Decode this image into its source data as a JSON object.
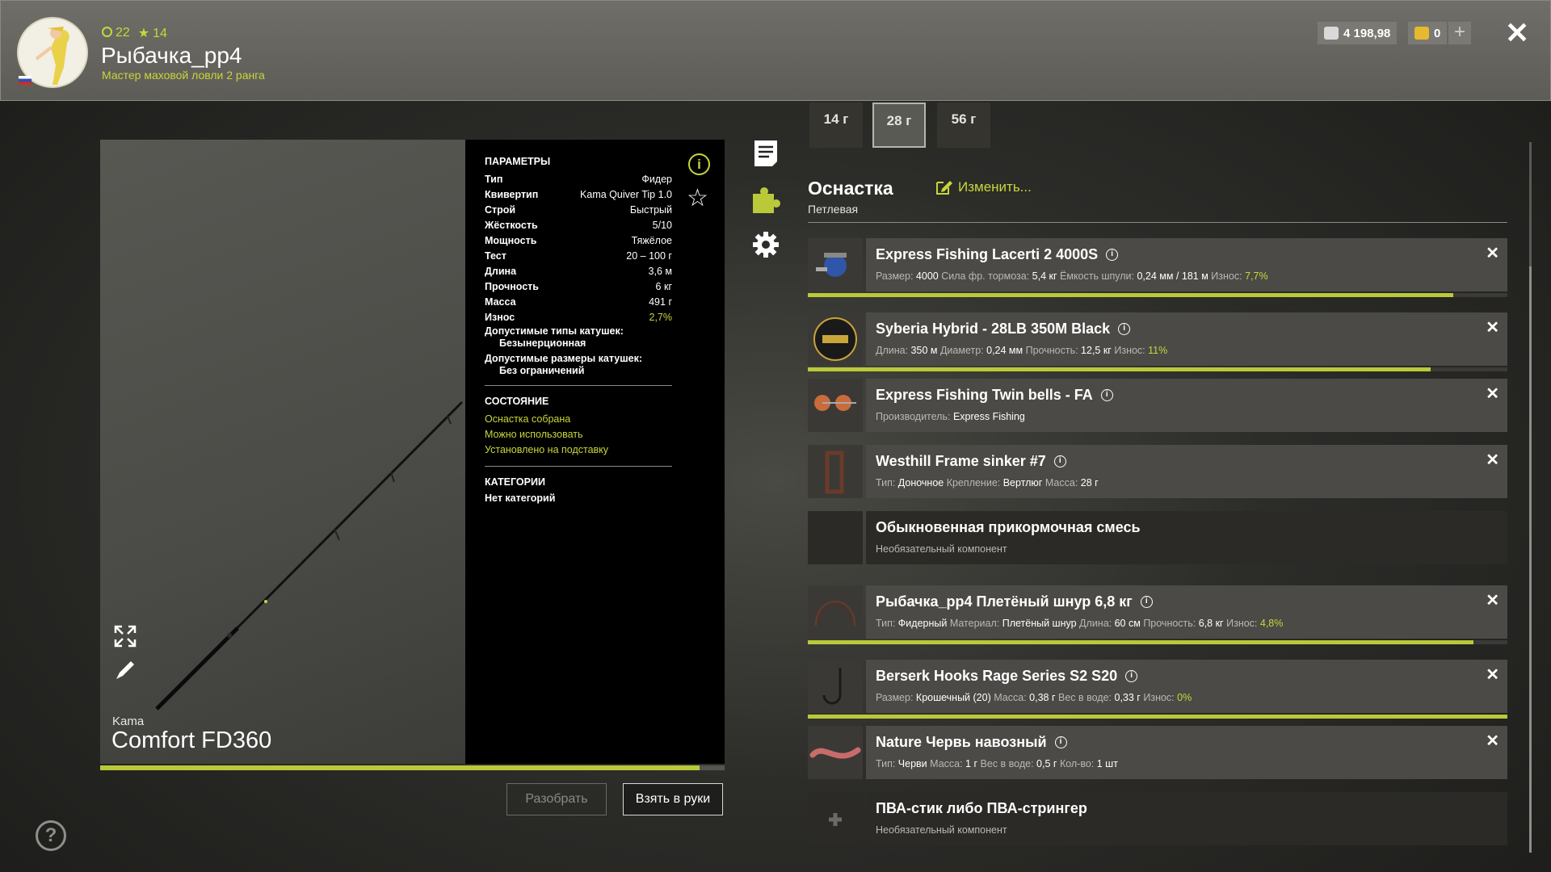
{
  "header": {
    "level": "22",
    "stars": "14",
    "player_name": "Рыбачка_pp4",
    "rank": "Мастер маховой ловли 2 ранга",
    "silver": "4 198,98",
    "gold": "0"
  },
  "rod": {
    "brand": "Kama",
    "name": "Comfort FD360",
    "wear_fraction": 0.96,
    "params_title": "ПАРАМЕТРЫ",
    "params": [
      {
        "k": "Тип",
        "v": "Фидер"
      },
      {
        "k": "Квивертип",
        "v": "Kama Quiver Tip 1.0"
      },
      {
        "k": "Строй",
        "v": "Быстрый"
      },
      {
        "k": "Жёсткость",
        "v": "5/10"
      },
      {
        "k": "Мощность",
        "v": "Тяжёлое"
      },
      {
        "k": "Тест",
        "v": "20 – 100 г"
      },
      {
        "k": "Длина",
        "v": "3,6 м"
      },
      {
        "k": "Прочность",
        "v": "6 кг"
      },
      {
        "k": "Масса",
        "v": "491 г"
      },
      {
        "k": "Износ",
        "v": "2,7%"
      }
    ],
    "reel_types_label": "Допустимые типы катушек:",
    "reel_types_value": "Безынерционная",
    "reel_sizes_label": "Допустимые размеры катушек:",
    "reel_sizes_value": "Без ограничений",
    "state_title": "СОСТОЯНИЕ",
    "states": [
      "Оснастка собрана",
      "Можно использовать",
      "Установлено на подставку"
    ],
    "categories_title": "КАТЕГОРИИ",
    "categories_value": "Нет категорий",
    "btn_disassemble": "Разобрать",
    "btn_take": "Взять в руки"
  },
  "weights": [
    "14 г",
    "28 г",
    "56 г"
  ],
  "tackle": {
    "title": "Оснастка",
    "subtitle": "Петлевая",
    "change": "Изменить..."
  },
  "items": [
    {
      "title": "Express Fishing Lacerti 2 4000S",
      "meta": [
        [
          "Размер:",
          "4000"
        ],
        [
          "Сила фр. тормоза:",
          "5,4 кг"
        ],
        [
          "Ёмкость шпули:",
          "0,24 мм / 181 м"
        ],
        [
          "Износ:",
          "7,7%"
        ]
      ],
      "bar": 0.923
    },
    {
      "title": "Syberia Hybrid - 28LB 350M Black",
      "meta": [
        [
          "Длина:",
          "350 м"
        ],
        [
          "Диаметр:",
          "0,24 мм"
        ],
        [
          "Прочность:",
          "12,5 кг"
        ],
        [
          "Износ:",
          "11%"
        ]
      ],
      "bar": 0.89
    },
    {
      "title": "Express Fishing Twin bells - FA",
      "meta": [
        [
          "Производитель:",
          "Express Fishing"
        ]
      ]
    },
    {
      "title": "Westhill Frame sinker #7",
      "meta": [
        [
          "Тип:",
          "Доночное"
        ],
        [
          "Крепление:",
          "Вертлюг"
        ],
        [
          "Масса:",
          "28 г"
        ]
      ]
    },
    {
      "title": "Обыкновенная прикормочная смесь",
      "meta": [
        [
          "Необязательный компонент",
          ""
        ]
      ]
    },
    {
      "title": "Рыбачка_pp4 Плетёный шнур 6,8 кг",
      "meta": [
        [
          "Тип:",
          "Фидерный"
        ],
        [
          "Материал:",
          "Плетёный шнур"
        ],
        [
          "Длина:",
          "60 см"
        ],
        [
          "Прочность:",
          "6,8 кг"
        ],
        [
          "Износ:",
          "4,8%"
        ]
      ],
      "bar": 0.952
    },
    {
      "title": "Berserk Hooks Rage Series S2 S20",
      "meta": [
        [
          "Размер:",
          "Крошечный (20)"
        ],
        [
          "Масса:",
          "0,38 г"
        ],
        [
          "Вес в воде:",
          "0,33 г"
        ],
        [
          "Износ:",
          "0%"
        ]
      ],
      "bar": 1.0
    },
    {
      "title": "Nature Червь навозный",
      "meta": [
        [
          "Тип:",
          "Черви"
        ],
        [
          "Масса:",
          "1 г"
        ],
        [
          "Вес в воде:",
          "0,5 г"
        ],
        [
          "Кол-во:",
          "1 шт"
        ]
      ]
    },
    {
      "title": "ПВА-стик либо ПВА-стрингер",
      "meta": [
        [
          "Необязательный компонент",
          ""
        ]
      ]
    }
  ],
  "colors": {
    "accent": "#c9d63a",
    "panel": "#4b4a46",
    "params_bg": "#000000"
  },
  "icons": [
    "notes-icon",
    "puzzle-icon",
    "gear-icon",
    "info-icon",
    "star-icon",
    "expand-icon",
    "pencil-icon",
    "help-icon",
    "close-icon"
  ]
}
